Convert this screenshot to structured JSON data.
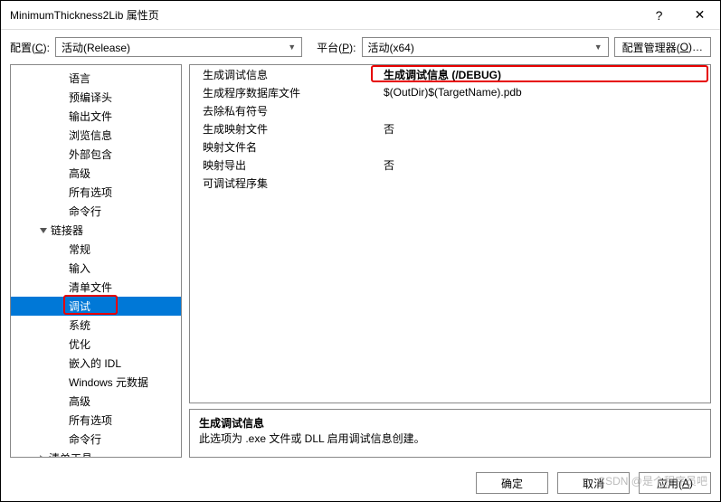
{
  "window": {
    "title": "MinimumThickness2Lib 属性页"
  },
  "config_row": {
    "config_label_pre": "配置(",
    "config_label_u": "C",
    "config_label_post": "):",
    "config_value": "活动(Release)",
    "platform_label_pre": "平台(",
    "platform_label_u": "P",
    "platform_label_post": "):",
    "platform_value": "活动(x64)",
    "manager_label_pre": "配置管理器(",
    "manager_label_u": "O",
    "manager_label_post": ")…"
  },
  "tree": {
    "items": [
      {
        "label": "语言",
        "indent": 64,
        "grp": 0
      },
      {
        "label": "预编译头",
        "indent": 64,
        "grp": 0
      },
      {
        "label": "输出文件",
        "indent": 64,
        "grp": 0
      },
      {
        "label": "浏览信息",
        "indent": 64,
        "grp": 0
      },
      {
        "label": "外部包含",
        "indent": 64,
        "grp": 0
      },
      {
        "label": "高级",
        "indent": 64,
        "grp": 0
      },
      {
        "label": "所有选项",
        "indent": 64,
        "grp": 0
      },
      {
        "label": "命令行",
        "indent": 64,
        "grp": 0
      },
      {
        "label": "链接器",
        "indent": 32,
        "grp": 1,
        "tri": "exp"
      },
      {
        "label": "常规",
        "indent": 64,
        "grp": 0
      },
      {
        "label": "输入",
        "indent": 64,
        "grp": 0
      },
      {
        "label": "清单文件",
        "indent": 64,
        "grp": 0
      },
      {
        "label": "调试",
        "indent": 64,
        "grp": 0,
        "sel": 1,
        "hl": 1
      },
      {
        "label": "系统",
        "indent": 64,
        "grp": 0
      },
      {
        "label": "优化",
        "indent": 64,
        "grp": 0
      },
      {
        "label": "嵌入的 IDL",
        "indent": 64,
        "grp": 0
      },
      {
        "label": "Windows 元数据",
        "indent": 64,
        "grp": 0
      },
      {
        "label": "高级",
        "indent": 64,
        "grp": 0
      },
      {
        "label": "所有选项",
        "indent": 64,
        "grp": 0
      },
      {
        "label": "命令行",
        "indent": 64,
        "grp": 0
      },
      {
        "label": "清单工具",
        "indent": 32,
        "grp": 1,
        "tri": "col"
      }
    ]
  },
  "props": {
    "rows": [
      {
        "name": "生成调试信息",
        "value": "生成调试信息 (/DEBUG)",
        "hl": 1,
        "bold": 1
      },
      {
        "name": "生成程序数据库文件",
        "value": "$(OutDir)$(TargetName).pdb"
      },
      {
        "name": "去除私有符号",
        "value": ""
      },
      {
        "name": "生成映射文件",
        "value": "否"
      },
      {
        "name": "映射文件名",
        "value": ""
      },
      {
        "name": "映射导出",
        "value": "否"
      },
      {
        "name": "可调试程序集",
        "value": ""
      }
    ]
  },
  "desc": {
    "title": "生成调试信息",
    "text": "此选项为 .exe 文件或 DLL 启用调试信息创建。"
  },
  "buttons": {
    "ok": "确定",
    "cancel": "取消",
    "apply_pre": "应用(",
    "apply_u": "A",
    "apply_post": ")"
  },
  "watermark": "CSDN @是个程序员吧"
}
